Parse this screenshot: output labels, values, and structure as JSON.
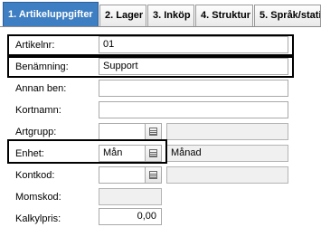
{
  "tabs": [
    {
      "label": "1. Artikeluppgifter",
      "active": true
    },
    {
      "label": "2. Lager",
      "active": false
    },
    {
      "label": "3. Inköp",
      "active": false
    },
    {
      "label": "4. Struktur",
      "active": false
    },
    {
      "label": "5. Språk/stati",
      "active": false
    }
  ],
  "form": {
    "artikelnr": {
      "label": "Artikelnr:",
      "value": "01"
    },
    "benamning": {
      "label": "Benämning:",
      "value": "Support"
    },
    "annan_ben": {
      "label": "Annan ben:",
      "value": ""
    },
    "kortnamn": {
      "label": "Kortnamn:",
      "value": ""
    },
    "artgrupp": {
      "label": "Artgrupp:",
      "value": "",
      "description": ""
    },
    "enhet": {
      "label": "Enhet:",
      "value": "Mån",
      "description": "Månad"
    },
    "kontkod": {
      "label": "Kontkod:",
      "value": "",
      "description": ""
    },
    "momskod": {
      "label": "Momskod:",
      "value": ""
    },
    "kalkylpris": {
      "label": "Kalkylpris:",
      "value": "0,00"
    }
  },
  "icons": {
    "lookup": "list-icon"
  },
  "colors": {
    "active_tab": "#3e7ec2",
    "highlight_border": "#000000"
  }
}
